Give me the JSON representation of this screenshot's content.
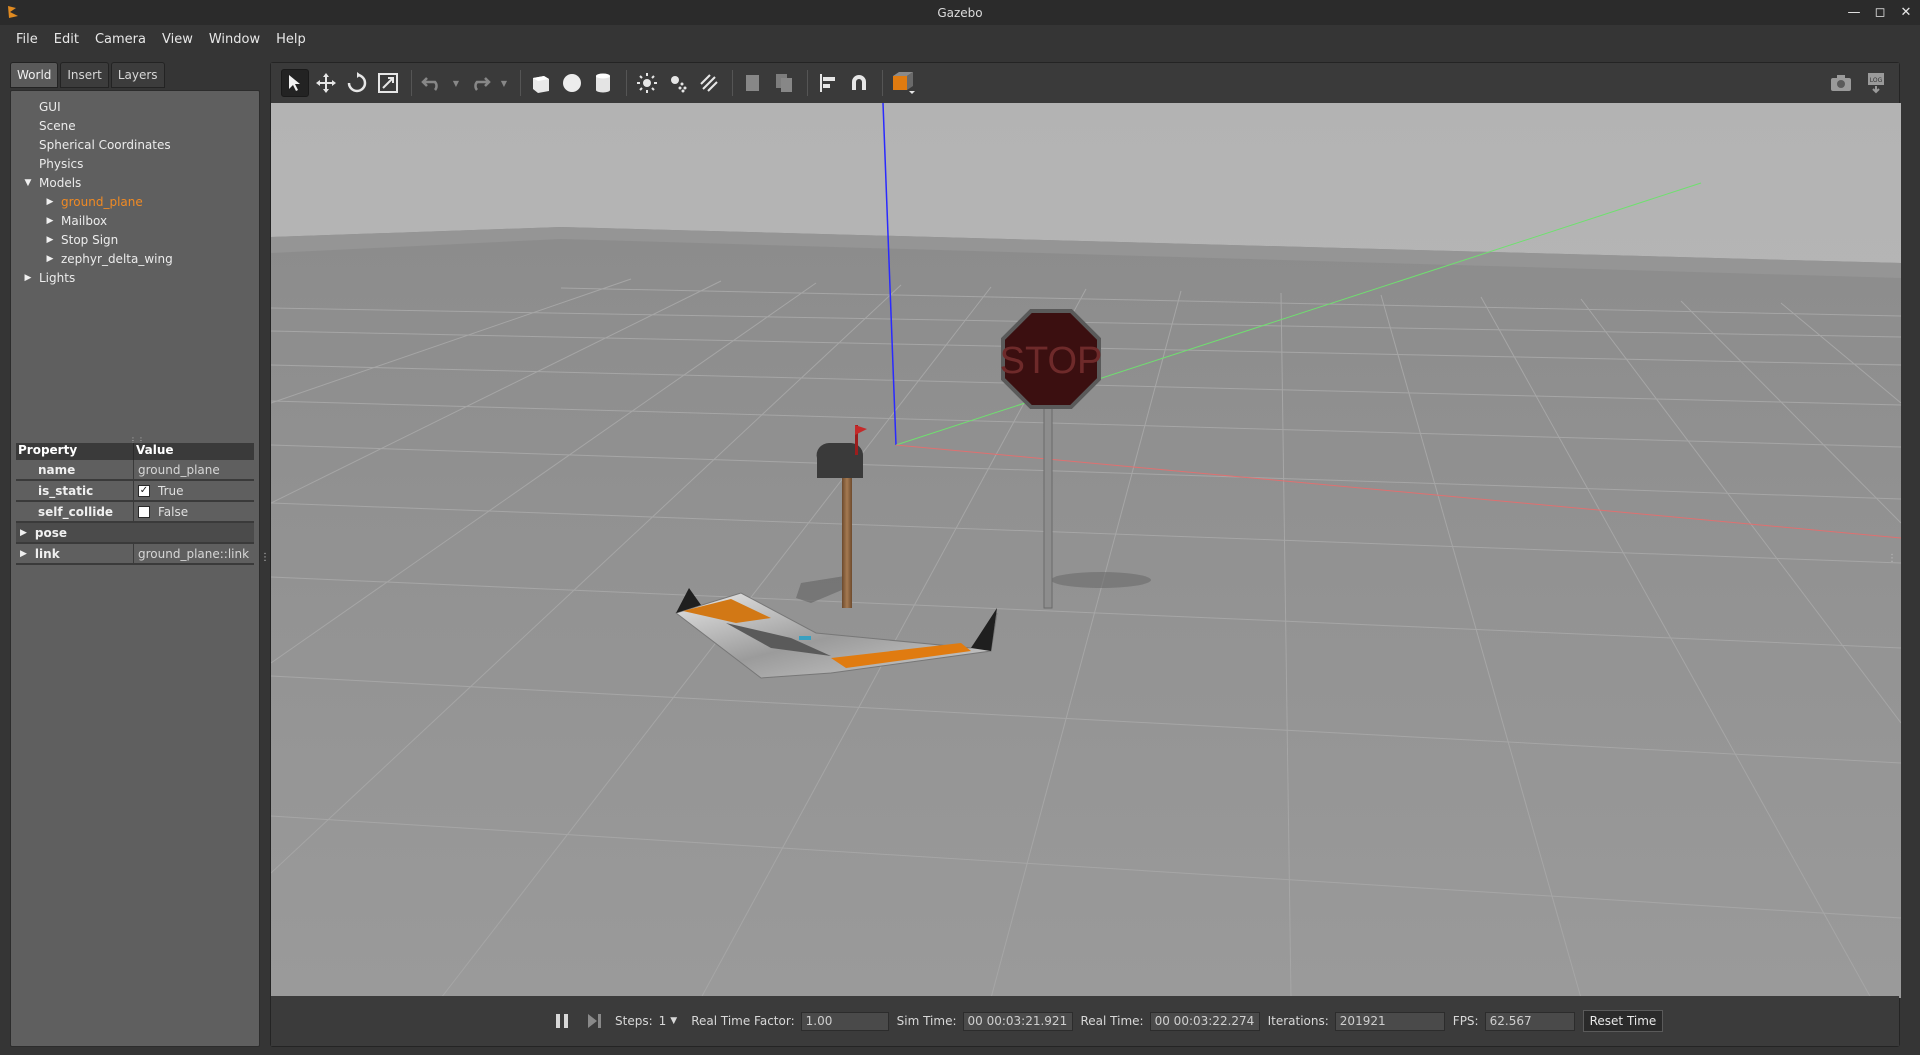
{
  "window": {
    "title": "Gazebo"
  },
  "menubar": {
    "items": [
      "File",
      "Edit",
      "Camera",
      "View",
      "Window",
      "Help"
    ]
  },
  "left_panel": {
    "tabs": [
      "World",
      "Insert",
      "Layers"
    ],
    "tree": {
      "gui": "GUI",
      "scene": "Scene",
      "spherical": "Spherical Coordinates",
      "physics": "Physics",
      "models": "Models",
      "model_items": [
        "ground_plane",
        "Mailbox",
        "Stop Sign",
        "zephyr_delta_wing"
      ],
      "lights": "Lights"
    },
    "properties": {
      "header_property": "Property",
      "header_value": "Value",
      "name_label": "name",
      "name_value": "ground_plane",
      "is_static_label": "is_static",
      "is_static_value": "True",
      "self_collide_label": "self_collide",
      "self_collide_value": "False",
      "pose_label": "pose",
      "link_label": "link",
      "link_value": "ground_plane::link"
    }
  },
  "viewport": {
    "scene_sign_text": "STOP"
  },
  "statusbar": {
    "steps_label": "Steps:",
    "steps_value": "1",
    "rtf_label": "Real Time Factor:",
    "rtf_value": "1.00",
    "sim_time_label": "Sim Time:",
    "sim_time_value": "00 00:03:21.921",
    "real_time_label": "Real Time:",
    "real_time_value": "00 00:03:22.274",
    "iterations_label": "Iterations:",
    "iterations_value": "201921",
    "fps_label": "FPS:",
    "fps_value": "62.567",
    "reset_label": "Reset Time"
  },
  "colors": {
    "selected": "#f08a24",
    "accent": "#e07b10"
  }
}
